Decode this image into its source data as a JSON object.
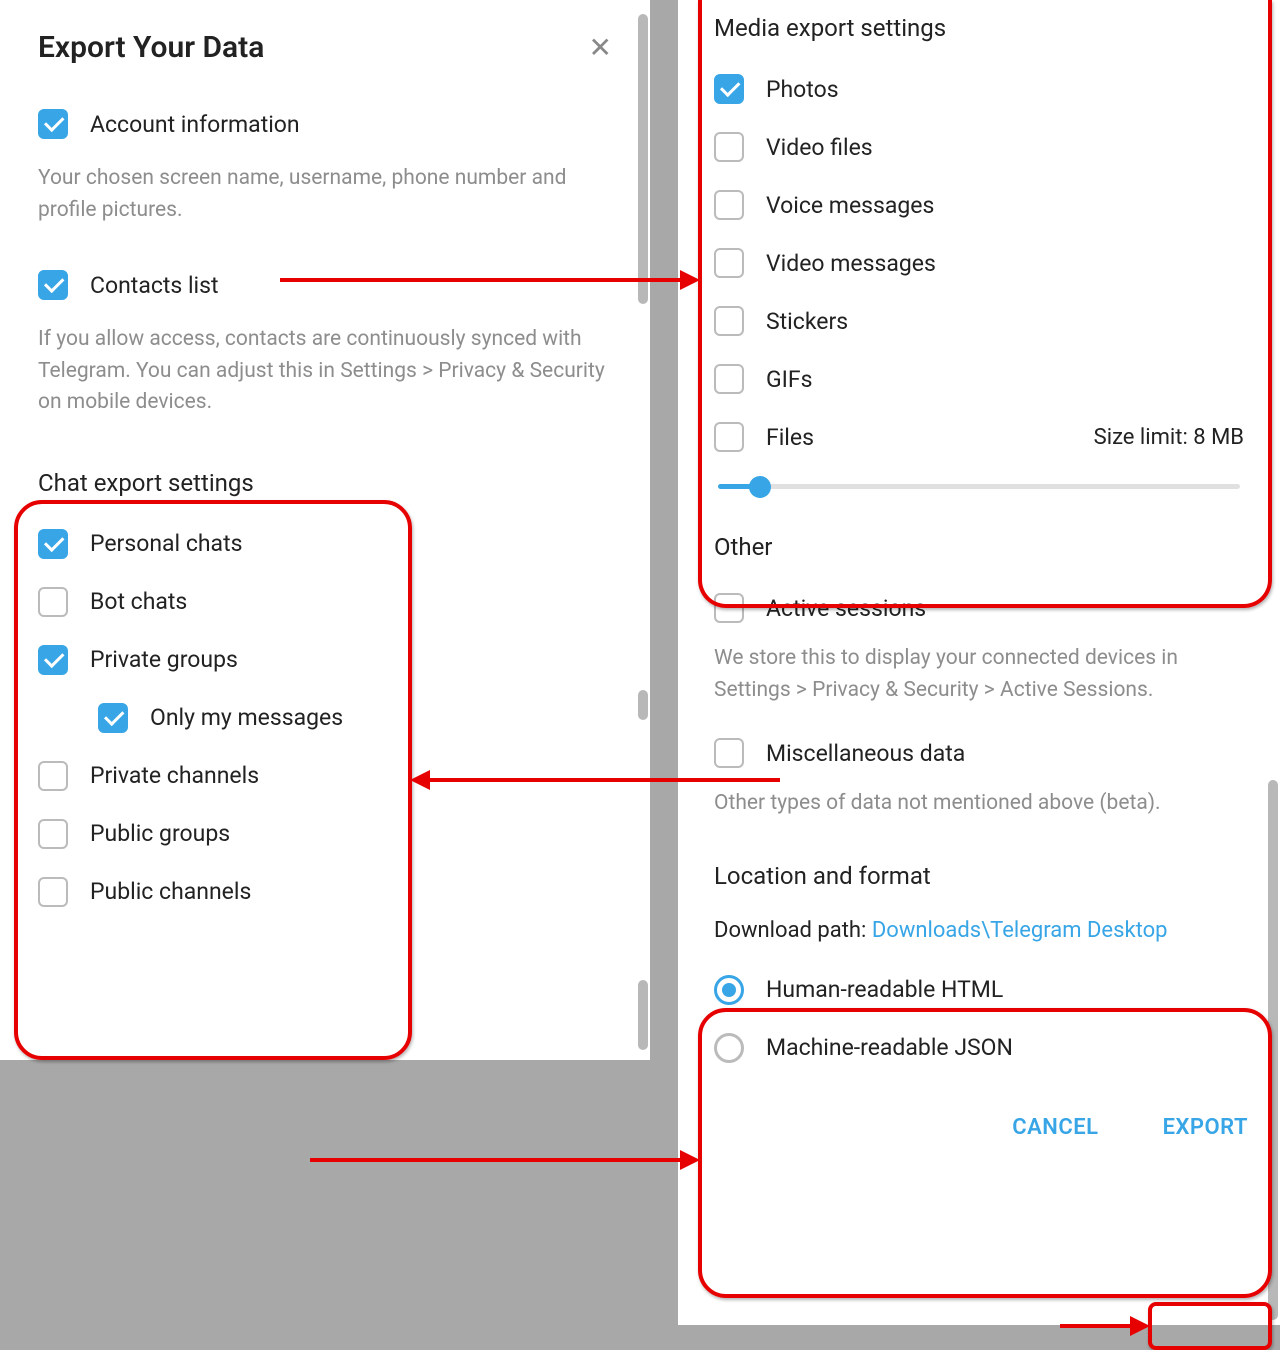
{
  "left": {
    "title": "Export Your Data",
    "account": {
      "label": "Account information",
      "desc": "Your chosen screen name, username, phone number and profile pictures."
    },
    "contacts": {
      "label": "Contacts list",
      "desc": "If you allow access, contacts are continuously synced with Telegram. You can adjust this in Settings > Privacy & Security on mobile devices."
    },
    "chat": {
      "title": "Chat export settings",
      "personal": "Personal chats",
      "bot": "Bot chats",
      "private_groups": "Private groups",
      "only_my": "Only my messages",
      "private_channels": "Private channels",
      "public_groups": "Public groups",
      "public_channels": "Public channels"
    }
  },
  "right": {
    "media": {
      "title": "Media export settings",
      "photos": "Photos",
      "video_files": "Video files",
      "voice_messages": "Voice messages",
      "video_messages": "Video messages",
      "stickers": "Stickers",
      "gifs": "GIFs",
      "files": "Files",
      "size_limit": "Size limit: 8 MB"
    },
    "other": {
      "title": "Other",
      "active_sessions": "Active sessions",
      "active_sessions_desc": "We store this to display your connected devices in Settings > Privacy & Security > Active Sessions.",
      "misc": "Miscellaneous data",
      "misc_desc": "Other types of data not mentioned above (beta)."
    },
    "location": {
      "title": "Location and format",
      "path_label": "Download path: ",
      "path_value": "Downloads\\Telegram Desktop",
      "html": "Human-readable HTML",
      "json": "Machine-readable JSON"
    },
    "buttons": {
      "cancel": "CANCEL",
      "export": "EXPORT"
    }
  }
}
